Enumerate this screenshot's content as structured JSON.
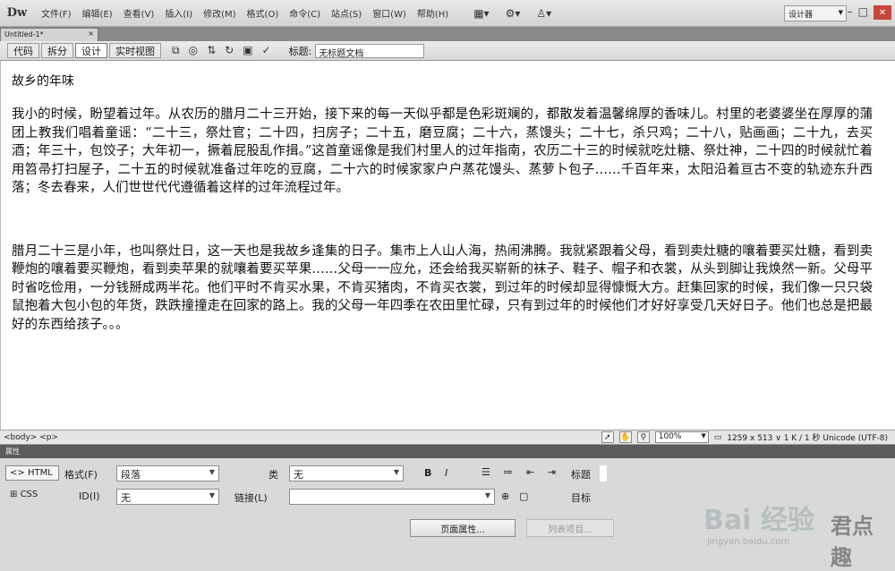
{
  "app": {
    "logo": "Dw",
    "menus": [
      "文件(F)",
      "编辑(E)",
      "查看(V)",
      "插入(I)",
      "修改(M)",
      "格式(O)",
      "命令(C)",
      "站点(S)",
      "窗口(W)",
      "帮助(H)"
    ],
    "workspace": "设计器",
    "toolbar_icons": [
      "layout-icon",
      "gear-icon",
      "extend-icon"
    ]
  },
  "tab": {
    "label": "Untitled-1*"
  },
  "doc_toolbar": {
    "views": [
      "代码",
      "拆分",
      "设计",
      "实时视图"
    ],
    "active_view": "设计",
    "title_label": "标题:",
    "title_value": "无标题文档"
  },
  "document": {
    "heading": "故乡的年味",
    "paragraphs": [
      "我小的时候，盼望着过年。从农历的腊月二十三开始，接下来的每一天似乎都是色彩斑斓的，都散发着温馨绵厚的香味儿。村里的老婆婆坐在厚厚的蒲团上教我们唱着童谣：“二十三，祭灶官；二十四，扫房子；二十五，磨豆腐；二十六，蒸馒头；二十七，杀只鸡；二十八，贴画画；二十九，去买酒；年三十，包饺子；大年初一，撅着屁股乱作揖。”这首童谣像是我们村里人的过年指南，农历二十三的时候就吃灶糖、祭灶神，二十四的时候就忙着用笤帚打扫屋子，二十五的时候就准备过年吃的豆腐，二十六的时候家家户户蒸花馒头、蒸萝卜包子……千百年来，太阳沿着亘古不变的轨迹东升西落；冬去春来，人们世世代代遵循着这样的过年流程过年。",
      "腊月二十三是小年，也叫祭灶日，这一天也是我故乡逢集的日子。集市上人山人海，热闹沸腾。我就紧跟着父母，看到卖灶糖的嚷着要买灶糖，看到卖鞭炮的嚷着要买鞭炮，看到卖苹果的就嚷着要买苹果……父母一一应允，还会给我买崭新的袜子、鞋子、帽子和衣裳，从头到脚让我焕然一新。父母平时省吃俭用，一分钱掰成两半花。他们平时不肯买水果，不肯买猪肉，不肯买衣裳，到过年的时候却显得慷慨大方。赶集回家的时候，我们像一只只袋鼠抱着大包小包的年货，跌跌撞撞走在回家的路上。我的父母一年四季在农田里忙碌，只有到过年的时候他们才好好享受几天好日子。他们也总是把最好的东西给孩子。。。"
    ]
  },
  "status": {
    "tags": "<body> <p>",
    "zoom": "100%",
    "info": "1259 x 513 ∨ 1 K / 1 秒 Unicode (UTF-8)"
  },
  "properties": {
    "header": "属性",
    "mode_html": "HTML",
    "mode_css": "CSS",
    "format_label": "格式(F)",
    "format_value": "段落",
    "class_label": "类",
    "class_value": "无",
    "id_label": "ID(I)",
    "id_value": "无",
    "link_label": "链接(L)",
    "link_value": "",
    "title_label": "标题",
    "target_label": "目标",
    "bold": "B",
    "italic": "I",
    "page_props_button": "页面属性...",
    "list_item_button": "列表项目..."
  },
  "watermark": {
    "brand": "Bai 经验",
    "sub": "jingyan.baidu.com",
    "badge": "君点趣"
  }
}
